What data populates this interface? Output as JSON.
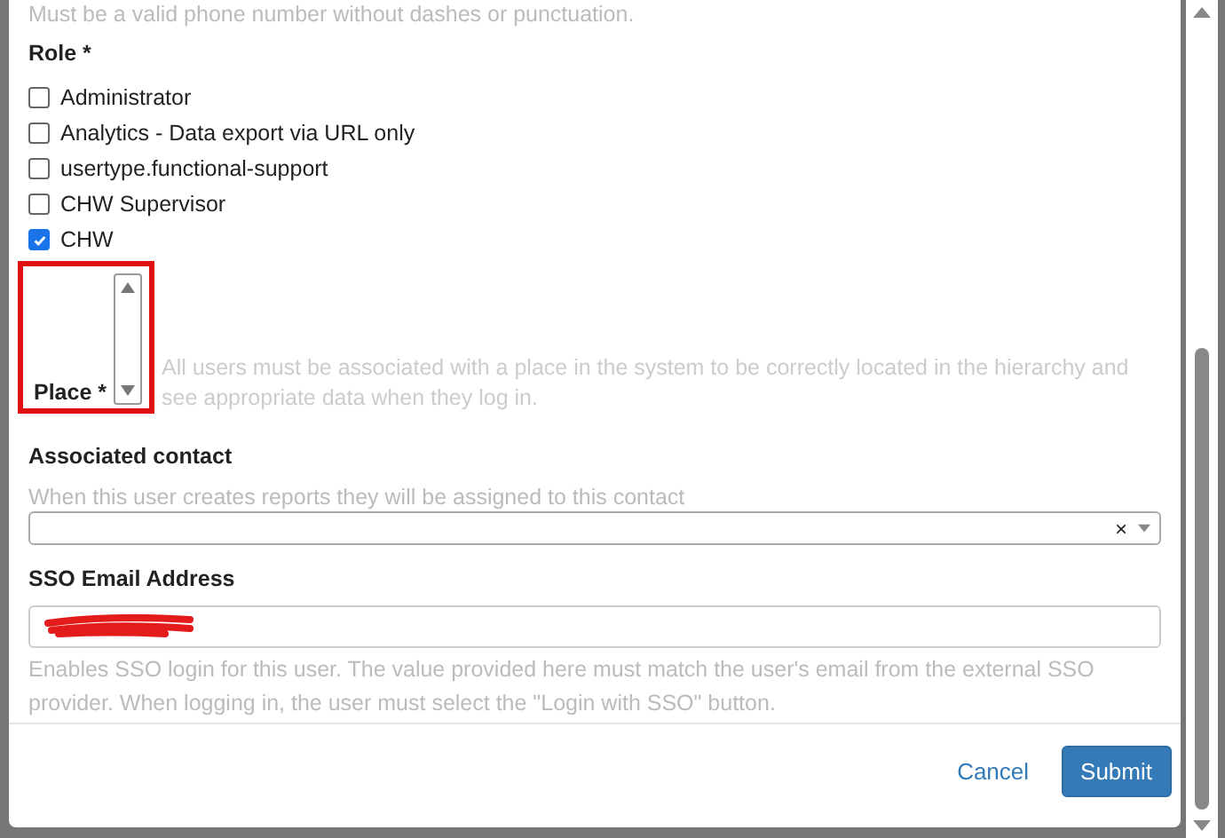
{
  "top_hint": "Must be a valid phone number without dashes or punctuation.",
  "role": {
    "label": "Role *",
    "options": [
      {
        "label": "Administrator",
        "checked": false
      },
      {
        "label": "Analytics - Data export via URL only",
        "checked": false
      },
      {
        "label": "usertype.functional-support",
        "checked": false
      },
      {
        "label": "CHW Supervisor",
        "checked": false
      },
      {
        "label": "CHW",
        "checked": true
      }
    ]
  },
  "place": {
    "label": "Place *",
    "hint": "All users must be associated with a place in the system to be correctly located in the hierarchy and see appropriate data when they log in.",
    "highlighted": true
  },
  "associated_contact": {
    "label": "Associated contact",
    "hint": "When this user creates reports they will be assigned to this contact",
    "clear": "×"
  },
  "sso_email": {
    "label": "SSO Email Address",
    "redacted": true,
    "hint": "Enables SSO login for this user. The value provided here must match the user's email from the external SSO provider. When logging in, the user must select the \"Login with SSO\" button."
  },
  "buttons": [
    {
      "label": "Cancel",
      "kind": "link"
    },
    {
      "label": "Submit",
      "kind": "primary"
    }
  ]
}
